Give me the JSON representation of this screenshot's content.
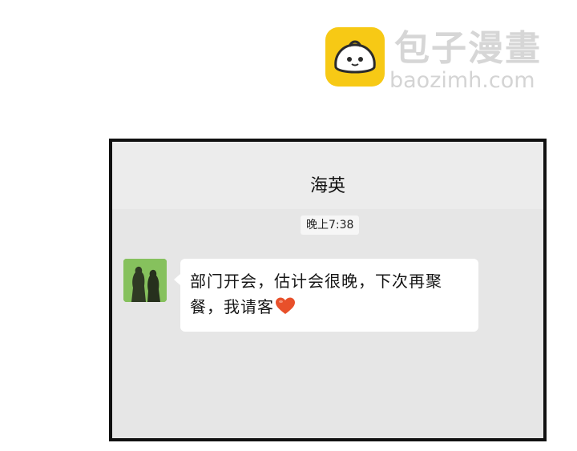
{
  "watermark": {
    "site_name": "包子漫畫",
    "url": "baozimh.com",
    "logo_icon": "baozi-bun-icon",
    "brand_color": "#f7c915"
  },
  "chat": {
    "contact_name": "海英",
    "timestamp": "晚上7:38",
    "message": {
      "text": "部门开会，估计会很晚，下次再聚餐，我请客",
      "emoji": "heart-icon",
      "emoji_color": "#e8502a"
    },
    "avatar_icon": "two-people-silhouette-avatar"
  }
}
